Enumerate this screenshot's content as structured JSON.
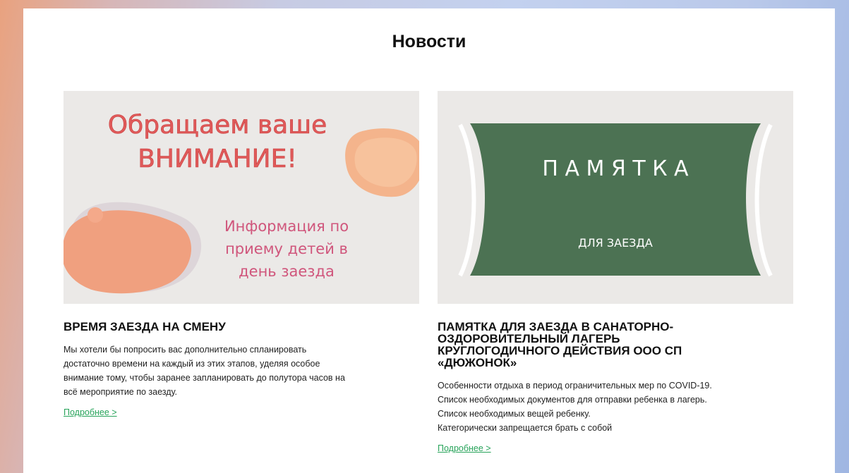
{
  "page": {
    "title": "Новости"
  },
  "cards": [
    {
      "image": {
        "headline_line1": "Обращаем ваше",
        "headline_line2": "ВНИМАНИЕ!",
        "sub_line1": "Информация по",
        "sub_line2": "приему детей в",
        "sub_line3": "день заезда",
        "colors": {
          "headline": "#d94a4a",
          "sub": "#d0567c",
          "blob": "#f2a27e"
        }
      },
      "title": "ВРЕМЯ ЗАЕЗДА НА СМЕНУ",
      "text_lines": [
        "Мы хотели бы попросить вас дополнительно спланировать",
        "достаточно времени на каждый из этих этапов, уделяя особое",
        "внимание тому, чтобы заранее запланировать до полутора часов на",
        "всё мероприятие по заезду."
      ],
      "link": "Подробнее >"
    },
    {
      "image": {
        "headline": "П А М Я Т К А",
        "sub": "ДЛЯ ЗАЕЗДА",
        "colors": {
          "banner": "#4c7253",
          "text": "#ffffff"
        }
      },
      "title_lines": [
        "ПАМЯТКА ДЛЯ ЗАЕЗДА В САНАТОРНО-",
        "ОЗДОРОВИТЕЛЬНЫЙ ЛАГЕРЬ",
        "КРУГЛОГОДИЧНОГО ДЕЙСТВИЯ  ООО СП",
        "«ДЮЖОНОК»"
      ],
      "text_lines": [
        "Особенности отдыха в период ограничительных мер по COVID-19.",
        "Список необходимых документов для отправки ребенка в лагерь.",
        "Список необходимых вещей ребенку.",
        "Категорически запрещается брать с собой"
      ],
      "link": "Подробнее >"
    }
  ],
  "colors": {
    "link": "#27a35a",
    "panel": "#ffffff"
  }
}
